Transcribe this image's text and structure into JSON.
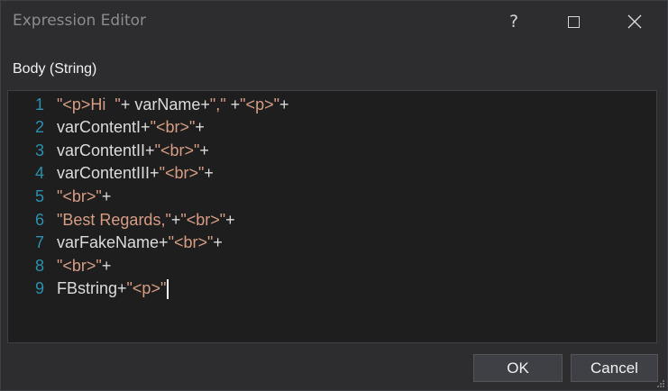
{
  "window": {
    "title": "Expression Editor",
    "help_label": "?"
  },
  "editor": {
    "label": "Body (String)",
    "lines": [
      {
        "n": "1",
        "segments": [
          [
            "s",
            "\"<p>Hi  \""
          ],
          [
            "c",
            "+ varName+"
          ],
          [
            "s",
            "\",\""
          ],
          [
            "c",
            " +"
          ],
          [
            "s",
            "\"<p>\""
          ],
          [
            "c",
            "+"
          ]
        ]
      },
      {
        "n": "2",
        "segments": [
          [
            "c",
            "varContentI+"
          ],
          [
            "s",
            "\"<br>\""
          ],
          [
            "c",
            "+"
          ]
        ]
      },
      {
        "n": "3",
        "segments": [
          [
            "c",
            "varContentII+"
          ],
          [
            "s",
            "\"<br>\""
          ],
          [
            "c",
            "+"
          ]
        ]
      },
      {
        "n": "4",
        "segments": [
          [
            "c",
            "varContentIII+"
          ],
          [
            "s",
            "\"<br>\""
          ],
          [
            "c",
            "+"
          ]
        ]
      },
      {
        "n": "5",
        "segments": [
          [
            "s",
            "\"<br>\""
          ],
          [
            "c",
            "+"
          ]
        ]
      },
      {
        "n": "6",
        "segments": [
          [
            "s",
            "\"Best Regards,\""
          ],
          [
            "c",
            "+"
          ],
          [
            "s",
            "\"<br>\""
          ],
          [
            "c",
            "+"
          ]
        ]
      },
      {
        "n": "7",
        "segments": [
          [
            "c",
            "varFakeName+"
          ],
          [
            "s",
            "\"<br>\""
          ],
          [
            "c",
            "+"
          ]
        ]
      },
      {
        "n": "8",
        "segments": [
          [
            "s",
            "\"<br>\""
          ],
          [
            "c",
            "+"
          ]
        ]
      },
      {
        "n": "9",
        "segments": [
          [
            "c",
            "FBstring+"
          ],
          [
            "s",
            "\"<p>\""
          ]
        ]
      }
    ]
  },
  "buttons": {
    "ok": "OK",
    "cancel": "Cancel"
  },
  "colors": {
    "line_number": "#2b91af",
    "identifier": "#dcdcdc",
    "string": "#d69d85",
    "background": "#1e1e1e"
  }
}
